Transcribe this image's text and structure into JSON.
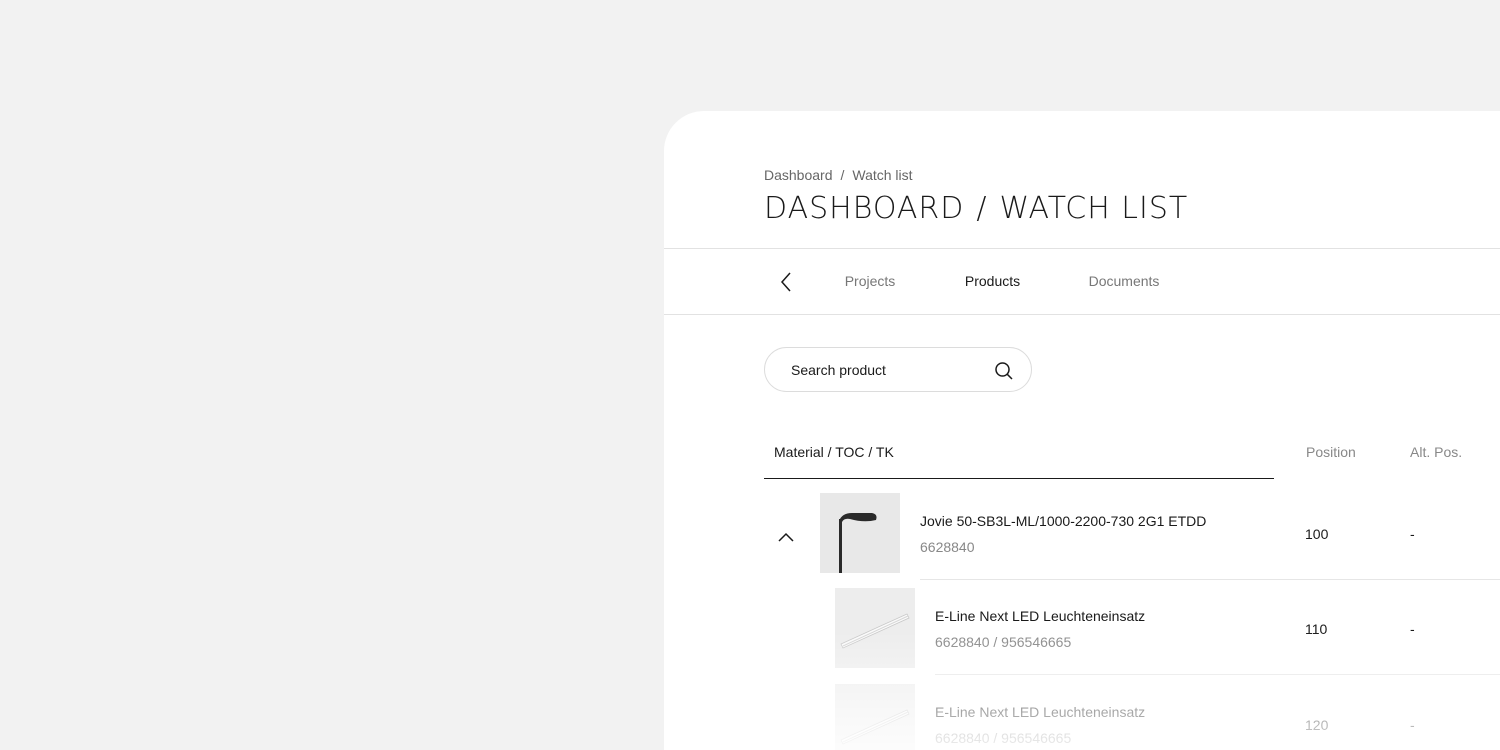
{
  "breadcrumb": {
    "items": [
      "Dashboard",
      "Watch list"
    ],
    "separator": "/"
  },
  "page_title": {
    "part1": "DASHBOARD",
    "separator": "/",
    "part2": "WATCH LIST"
  },
  "tabs": [
    {
      "label": "Projects",
      "active": false
    },
    {
      "label": "Products",
      "active": true
    },
    {
      "label": "Documents",
      "active": false
    }
  ],
  "search": {
    "placeholder": "Search product"
  },
  "table": {
    "headers": {
      "material": "Material / TOC / TK",
      "position": "Position",
      "alt_pos": "Alt. Pos."
    },
    "rows": [
      {
        "name": "Jovie 50-SB3L-ML/1000-2200-730 2G1 ETDD",
        "id": "6628840",
        "position": "100",
        "alt_pos": "-",
        "expanded": true
      },
      {
        "name": "E-Line Next LED Leuchteneinsatz",
        "id": "6628840 / 956546665",
        "position": "110",
        "alt_pos": "-"
      },
      {
        "name": "E-Line Next LED Leuchteneinsatz",
        "id": "6628840 / 956546665",
        "position": "120",
        "alt_pos": "-"
      }
    ]
  },
  "icons": {
    "back": "chevron-left-icon",
    "search": "search-icon",
    "collapse": "chevron-up-icon"
  }
}
